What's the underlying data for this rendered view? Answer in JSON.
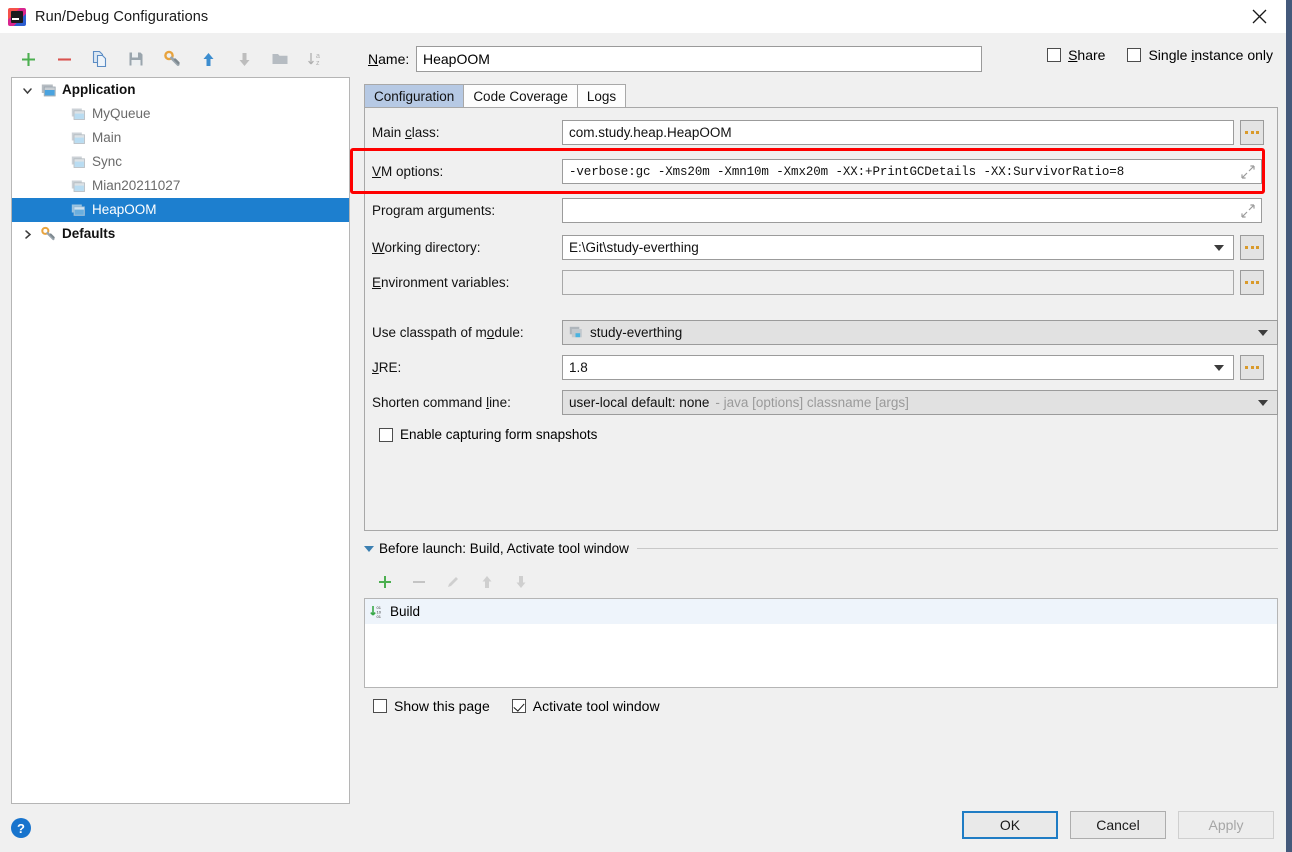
{
  "window": {
    "title": "Run/Debug Configurations",
    "app_icon": "intellij-idea-icon",
    "close_icon": "close-icon"
  },
  "left_toolbar": {
    "buttons": [
      {
        "name": "add-configuration-button",
        "icon": "plus-icon",
        "label": "+"
      },
      {
        "name": "remove-configuration-button",
        "icon": "minus-icon",
        "label": "−"
      },
      {
        "name": "copy-configuration-button",
        "icon": "copy-icon",
        "label": ""
      },
      {
        "name": "save-configuration-button",
        "icon": "save-icon",
        "label": ""
      },
      {
        "name": "edit-defaults-button",
        "icon": "wrench-icon",
        "label": ""
      },
      {
        "name": "move-up-button",
        "icon": "arrow-up-icon",
        "label": ""
      },
      {
        "name": "move-down-button",
        "icon": "arrow-down-icon",
        "label": ""
      },
      {
        "name": "new-folder-button",
        "icon": "folder-icon",
        "label": ""
      },
      {
        "name": "sort-alphabetically-button",
        "icon": "sort-az-icon",
        "label": ""
      }
    ]
  },
  "tree": {
    "nodes": [
      {
        "label": "Application",
        "type": "group",
        "expanded": true,
        "icon": "application-icon",
        "twisty": "⌄",
        "selected": false
      },
      {
        "label": "MyQueue",
        "type": "child",
        "icon": "run-config-icon",
        "selected": false
      },
      {
        "label": "Main",
        "type": "child",
        "icon": "run-config-icon",
        "selected": false
      },
      {
        "label": "Sync",
        "type": "child",
        "icon": "run-config-icon",
        "selected": false
      },
      {
        "label": "Mian20211027",
        "type": "child",
        "icon": "run-config-icon",
        "selected": false
      },
      {
        "label": "HeapOOM",
        "type": "child",
        "icon": "run-config-icon",
        "selected": true
      },
      {
        "label": "Defaults",
        "type": "group",
        "expanded": false,
        "icon": "wrench-icon",
        "twisty": "›",
        "selected": false
      }
    ]
  },
  "header": {
    "name_label": "Name:",
    "name_value": "HeapOOM",
    "share_label": "Share",
    "share_checked": false,
    "single_instance_label": "Single instance only",
    "single_instance_checked": false
  },
  "tabs": [
    {
      "label": "Configuration",
      "active": true,
      "name": "tab-configuration"
    },
    {
      "label": "Code Coverage",
      "active": false,
      "name": "tab-code-coverage"
    },
    {
      "label": "Logs",
      "active": false,
      "name": "tab-logs"
    }
  ],
  "form": {
    "main_class": {
      "label": "Main class:",
      "value": "com.study.heap.HeapOOM",
      "browse": "..."
    },
    "vm_options": {
      "label": "VM options:",
      "value": "-verbose:gc -Xms20m -Xmn10m -Xmx20m -XX:+PrintGCDetails -XX:SurvivorRatio=8",
      "highlighted": true,
      "highlight_color": "#fe0000"
    },
    "program_arguments": {
      "label": "Program arguments:",
      "value": ""
    },
    "working_directory": {
      "label": "Working directory:",
      "value": "E:\\Git\\study-everthing",
      "browse": "..."
    },
    "environment_variables": {
      "label": "Environment variables:",
      "value": "",
      "browse": "..."
    },
    "classpath_module": {
      "label": "Use classpath of module:",
      "value": "study-everthing",
      "icon": "module-icon"
    },
    "jre": {
      "label": "JRE:",
      "value": "1.8",
      "browse": "..."
    },
    "shorten_command_line": {
      "label": "Shorten command line:",
      "value": "user-local default: none",
      "hint": "- java [options] classname [args]"
    },
    "enable_snapshots": {
      "label": "Enable capturing form snapshots",
      "checked": false
    }
  },
  "before_launch": {
    "title": "Before launch: Build, Activate tool window",
    "toolbar": [
      {
        "name": "add-task-button",
        "icon": "plus-icon"
      },
      {
        "name": "remove-task-button",
        "icon": "minus-icon"
      },
      {
        "name": "edit-task-button",
        "icon": "pencil-icon"
      },
      {
        "name": "task-move-up-button",
        "icon": "arrow-up-icon"
      },
      {
        "name": "task-move-down-button",
        "icon": "arrow-down-icon"
      }
    ],
    "items": [
      {
        "label": "Build",
        "icon": "build-icon"
      }
    ],
    "show_this_page": {
      "label": "Show this page",
      "checked": false
    },
    "activate_tool_window": {
      "label": "Activate tool window",
      "checked": true
    }
  },
  "footer": {
    "help_label": "?",
    "ok_label": "OK",
    "cancel_label": "Cancel",
    "apply_label": "Apply",
    "apply_disabled": true
  }
}
